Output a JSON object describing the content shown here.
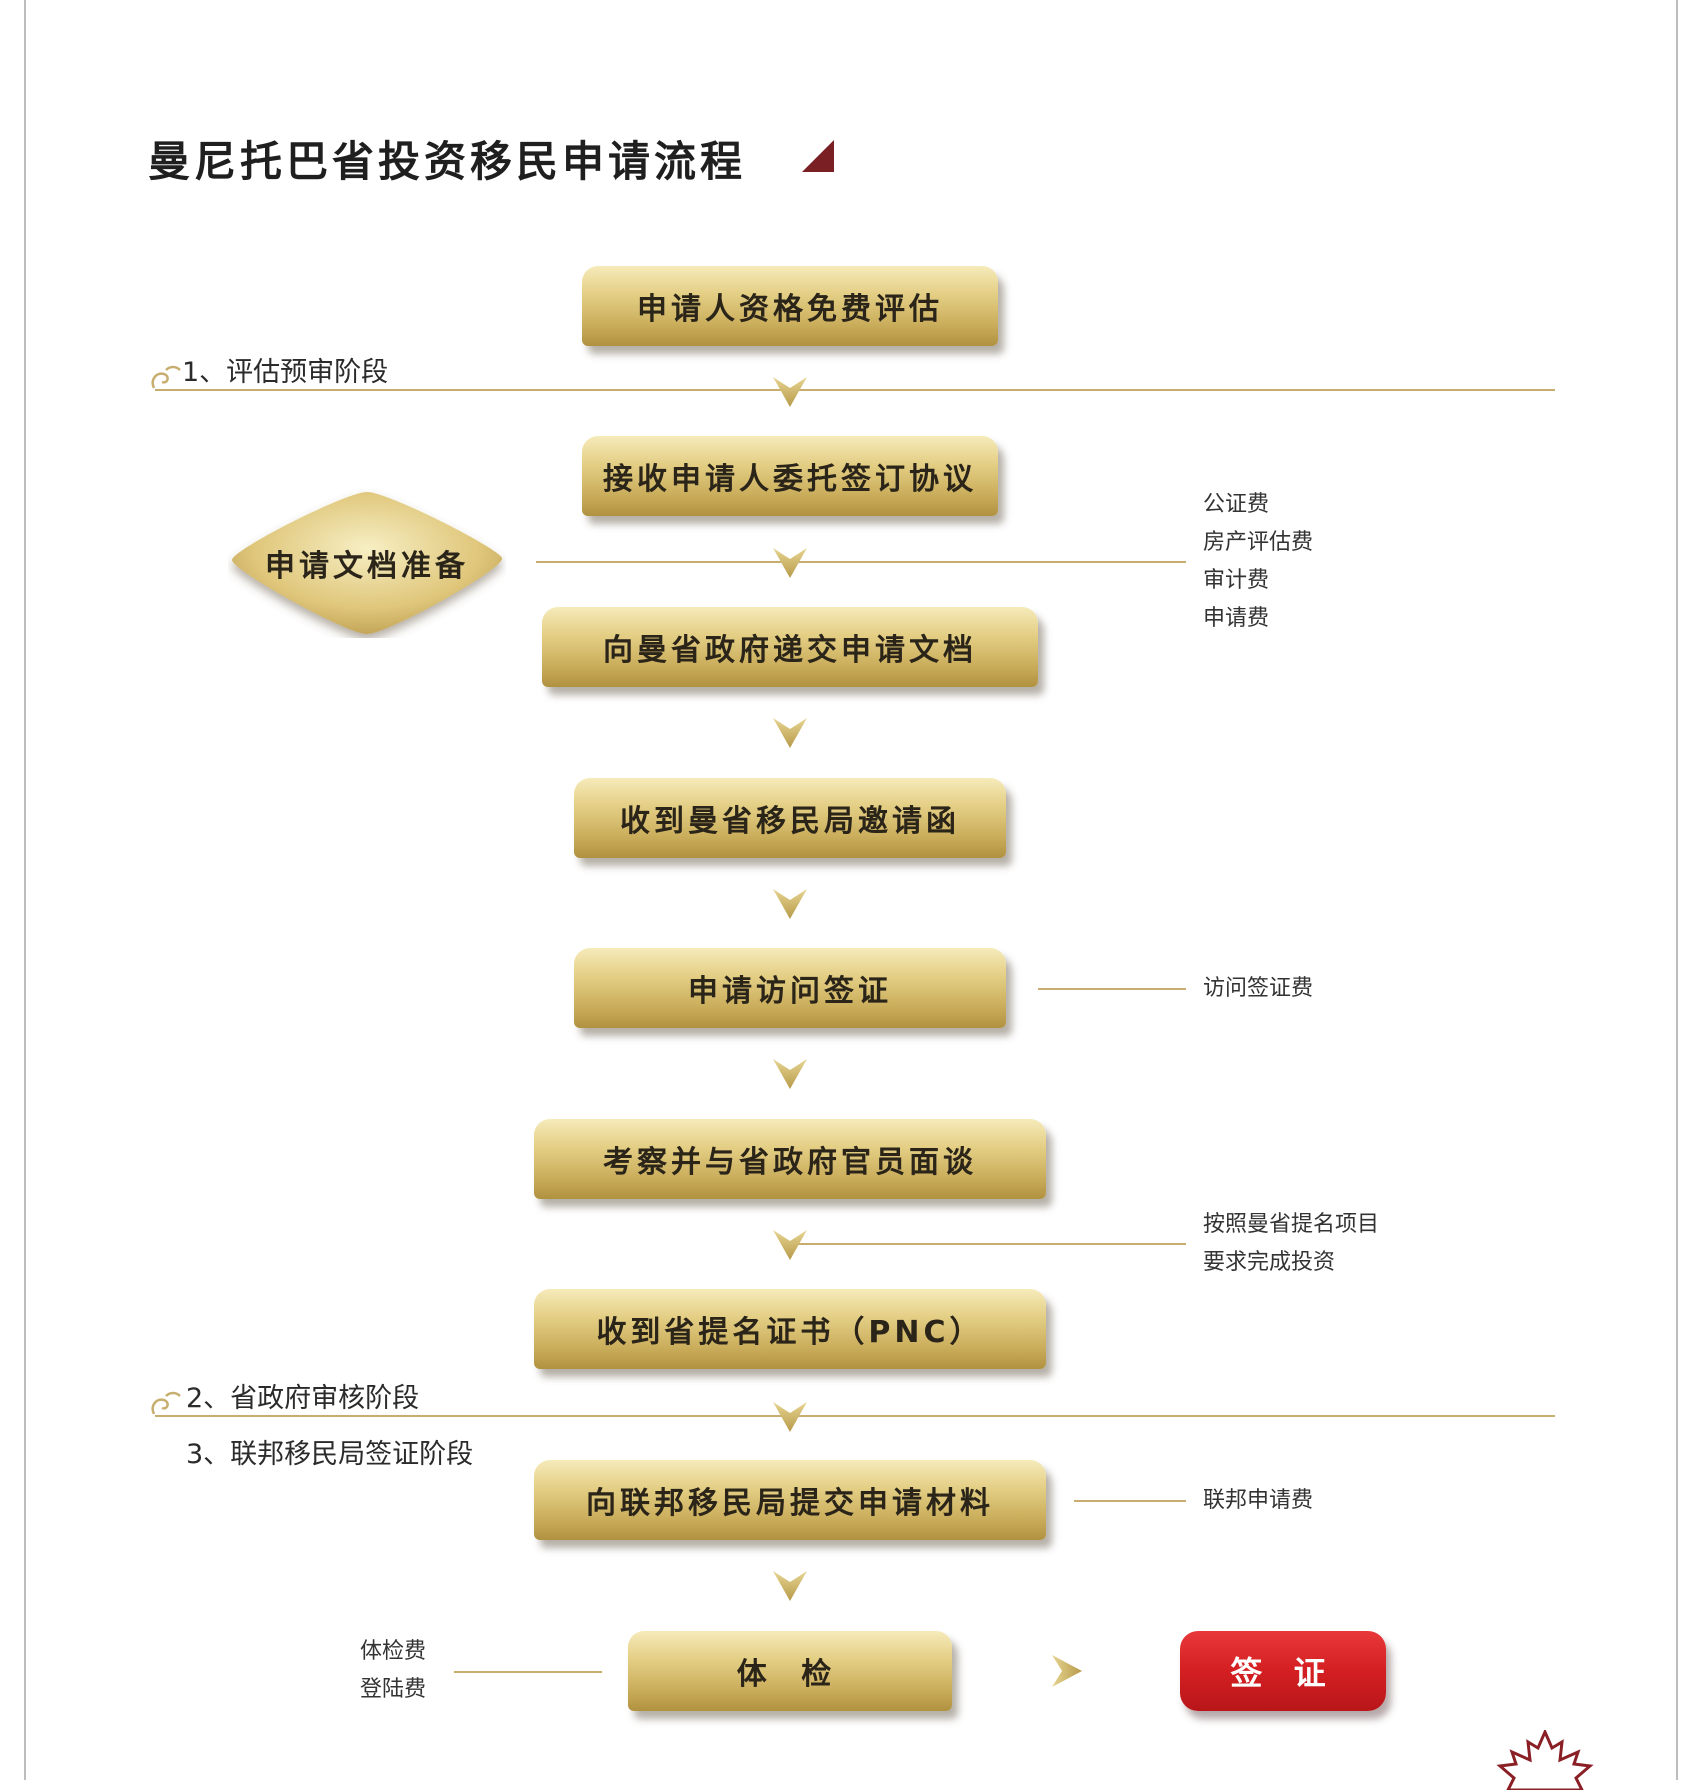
{
  "page_title": "曼尼托巴省投资移民申请流程",
  "stages": {
    "stage1": "1、评估预审阶段",
    "stage2": "2、省政府审核阶段",
    "stage3": "3、联邦移民局签证阶段"
  },
  "steps": {
    "step1": "申请人资格免费评估",
    "step2": "接收申请人委托签订协议",
    "step3": "向曼省政府递交申请文档",
    "step4": "收到曼省移民局邀请函",
    "step5": "申请访问签证",
    "step6": "考察并与省政府官员面谈",
    "step7": "收到省提名证书（PNC）",
    "step8": "向联邦移民局提交申请材料",
    "step9": "体 检",
    "final": "签 证"
  },
  "side_process": "申请文档准备",
  "fees": {
    "docs": [
      "公证费",
      "房产评估费",
      "审计费",
      "申请费"
    ],
    "visit_visa": "访问签证费",
    "investment": [
      "按照曼省提名项目",
      "要求完成投资"
    ],
    "federal": "联邦申请费",
    "medical": [
      "体检费",
      "登陆费"
    ]
  },
  "colors": {
    "gold": "#d9c171",
    "gold_line": "#c8ae6e",
    "red": "#d41f22",
    "title_mark": "#7a1f24"
  }
}
